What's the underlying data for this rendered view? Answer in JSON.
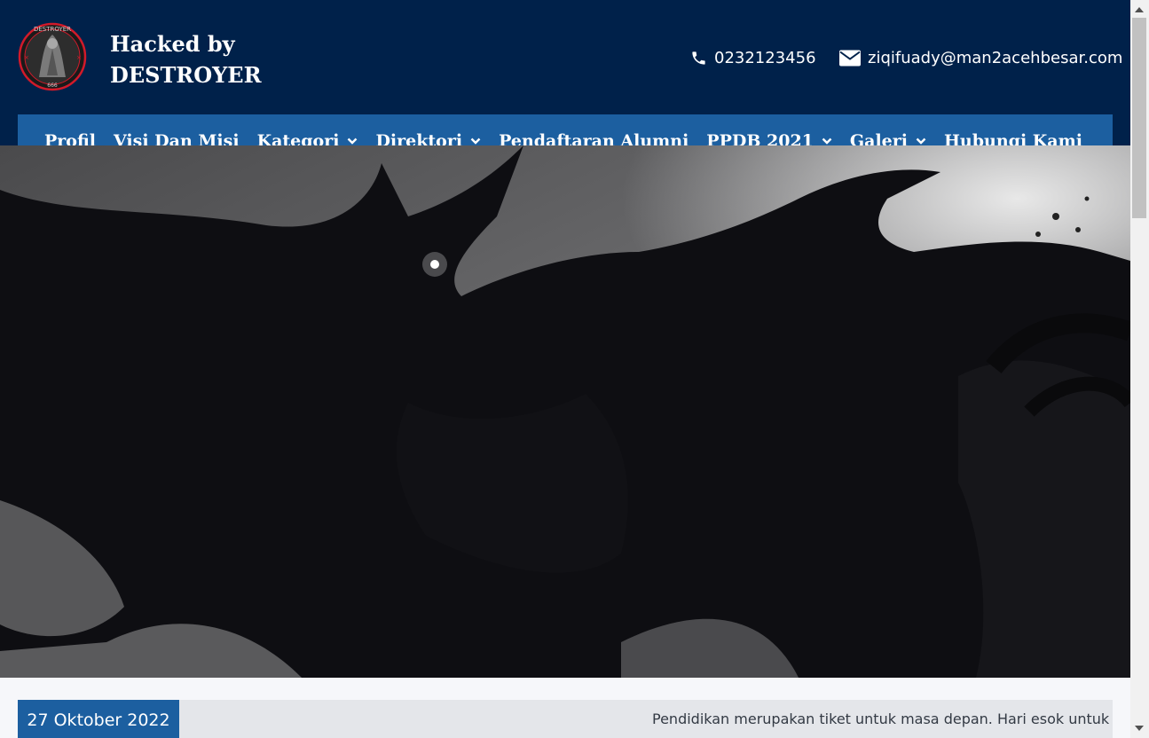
{
  "header": {
    "title_line1": "Hacked by",
    "title_line2": "DESTROYER",
    "phone": "0232123456",
    "email": "ziqifuady@man2acehbesar.com",
    "logo_text_top": "DESTROYER",
    "logo_text_bottom": "666"
  },
  "nav": {
    "items": [
      {
        "label": "Profil"
      },
      {
        "label": "Visi Dan Misi"
      },
      {
        "label": "Kategori"
      },
      {
        "label": "Direktori"
      },
      {
        "label": "Pendaftaran Alumni"
      },
      {
        "label": "PPDB 2021"
      },
      {
        "label": "Galeri"
      },
      {
        "label": "Hubungi Kami"
      }
    ]
  },
  "ticker": {
    "date": "27 Oktober 2022",
    "text": "Pendidikan merupakan tiket untuk masa depan. Hari esok untuk oran"
  },
  "colors": {
    "header_bg": "#00214a",
    "nav_bg": "#1c5fa0",
    "nav_border": "#f4d000"
  }
}
